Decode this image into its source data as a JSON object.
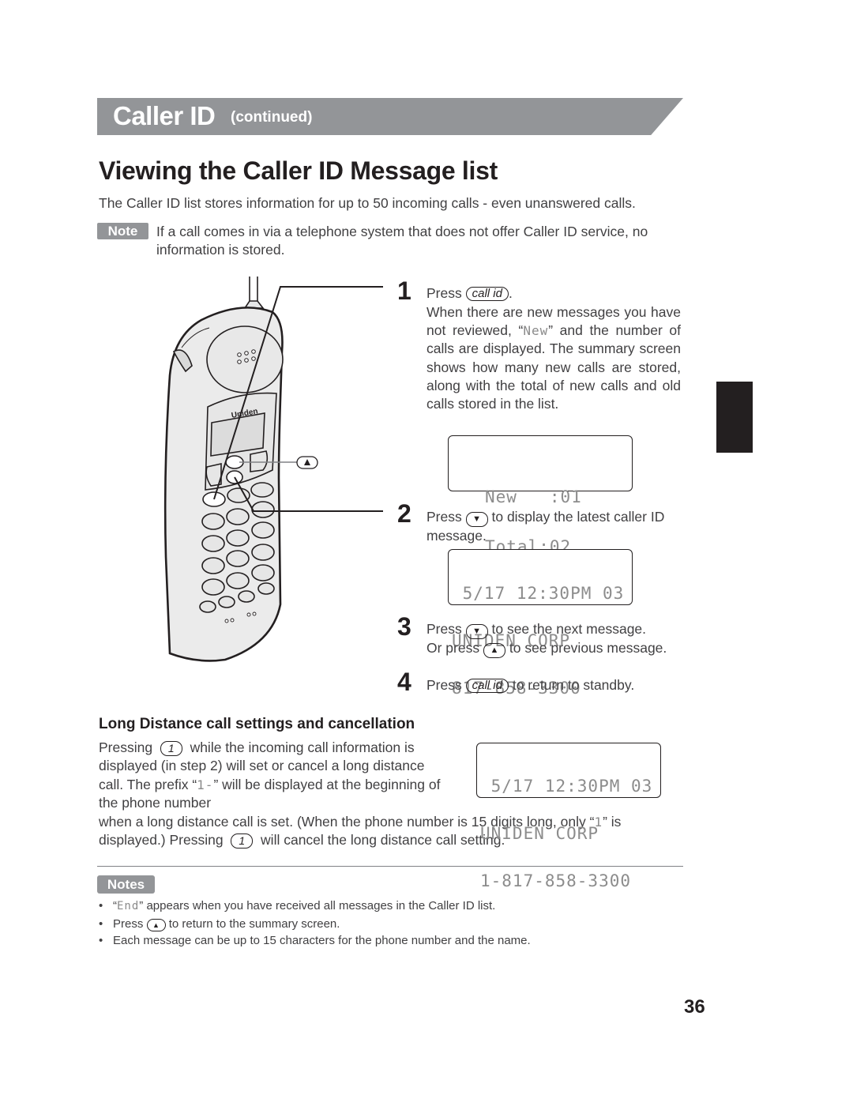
{
  "header": {
    "section_title": "Caller ID",
    "section_sub": "(continued)"
  },
  "page_title": "Viewing the Caller ID Message list",
  "intro": "The Caller ID list stores information for up to 50 incoming calls - even unanswered calls.",
  "note": {
    "badge": "Note",
    "text": "If a call comes in via a telephone system that does not offer Caller ID service, no information is stored."
  },
  "illustration": {
    "brand": "Uniden",
    "callout_key": "▲"
  },
  "keys": {
    "call_id": "call id",
    "down": "▼",
    "up": "▲",
    "one": "1"
  },
  "steps": [
    {
      "number": "1",
      "press": "Press",
      "after_key": ".",
      "body_pre": "When there are new messages you have not reviewed, “",
      "lcd_word": "New",
      "body_post": "” and the number of calls are displayed. The summary screen shows how many new calls are stored, along with the total of new calls and old calls stored in the list.",
      "display": [
        "New   :01",
        "Total:02"
      ]
    },
    {
      "number": "2",
      "press": "Press",
      "text": "to display the latest caller ID message.",
      "display": [
        " 5/17 12:30PM 03",
        "UNIDEN CORP",
        "817-858-3300"
      ]
    },
    {
      "number": "3",
      "press": "Press",
      "text": "to see the next message.",
      "or_press": "Or press",
      "text2": "to see previous message."
    },
    {
      "number": "4",
      "press": "Press",
      "text": "to return to standby."
    }
  ],
  "long_distance": {
    "heading": "Long Distance call settings and cancellation",
    "p1_pre": "Pressing",
    "p1_post": "while the incoming call information is displayed (in step 2) will set or cancel a long distance call. The prefix “",
    "prefix": "1-",
    "p1_post2": "” will be displayed at the beginning of the phone number",
    "p2_pre": "when a long distance call is set. (When the phone number is 15 digits long, only “",
    "only": "1",
    "p2_mid": "” is displayed.) Pressing",
    "p2_post": "will cancel the long distance call setting.",
    "display": [
      " 5/17 12:30PM 03",
      "UNIDEN CORP",
      "1-817-858-3300"
    ]
  },
  "notes": {
    "badge": "Notes",
    "items": [
      {
        "pre": "“",
        "lcd": "End",
        "post": "” appears when you have received all messages in the Caller ID list."
      },
      {
        "pre": "Press",
        "post": "to return to the summary screen."
      },
      {
        "text": "Each message can be up to 15 characters for the phone number and the name."
      }
    ]
  },
  "page_number": "36"
}
